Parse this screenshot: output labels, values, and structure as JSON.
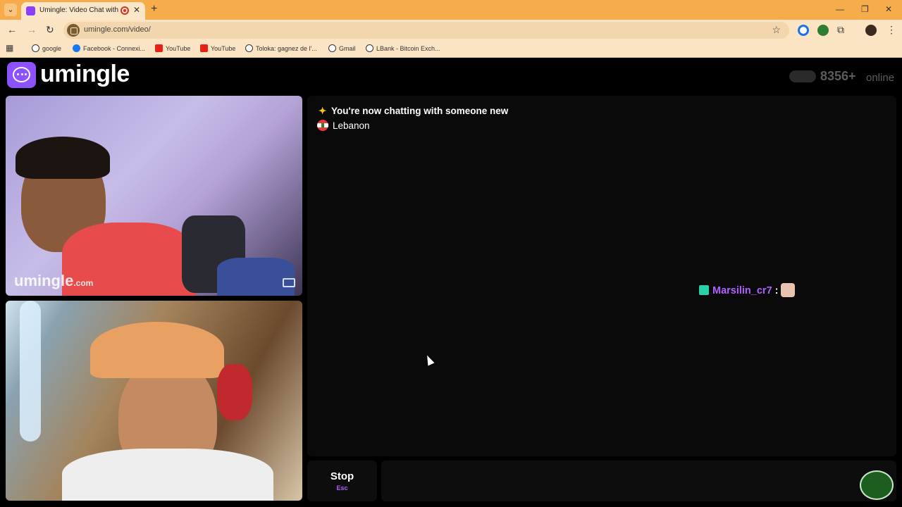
{
  "browser": {
    "tab_title": "Umingle: Video Chat with S",
    "url": "umingle.com/video/",
    "bookmarks": [
      {
        "label": "google",
        "icon": "globe-icon"
      },
      {
        "label": "Facebook - Connexi...",
        "icon": "facebook-icon"
      },
      {
        "label": "YouTube",
        "icon": "youtube-icon"
      },
      {
        "label": "YouTube",
        "icon": "youtube-icon"
      },
      {
        "label": "Toloka: gagnez de l'...",
        "icon": "globe-icon"
      },
      {
        "label": "Gmail",
        "icon": "globe-icon"
      },
      {
        "label": "LBank - Bitcoin Exch...",
        "icon": "globe-icon"
      }
    ]
  },
  "header": {
    "logo_text": "umingle",
    "online_count": "8356+",
    "online_label": "online"
  },
  "video": {
    "watermark_main": "umingle",
    "watermark_suffix": ".com"
  },
  "chat": {
    "system_message": "You're now chatting with someone new",
    "country": "Lebanon",
    "messages": [
      {
        "user": "Marsilin_cr7",
        "separator": ":"
      }
    ]
  },
  "controls": {
    "stop_label": "Stop",
    "stop_key": "Esc"
  },
  "colors": {
    "accent": "#8c52ff",
    "username": "#b061ff",
    "tabbar": "#f6ac4a"
  }
}
